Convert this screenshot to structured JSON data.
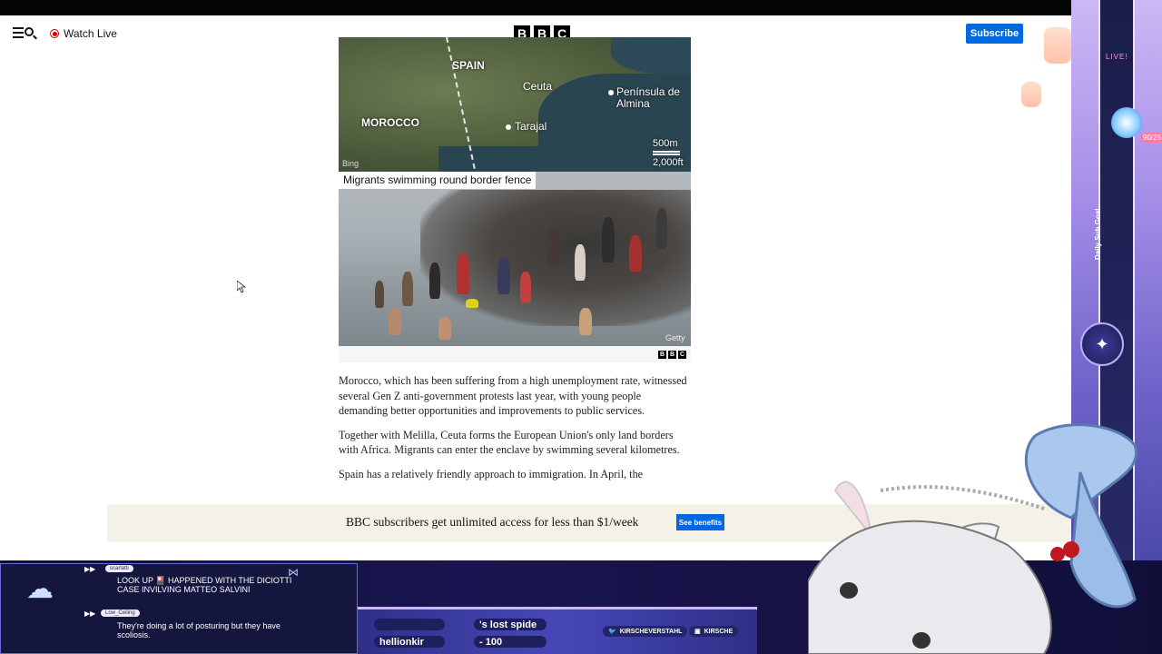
{
  "header": {
    "watch_live": "Watch Live",
    "logo_letters": [
      "B",
      "B",
      "C"
    ],
    "subscribe": "Subscribe"
  },
  "map": {
    "labels": {
      "spain": "SPAIN",
      "morocco": "MOROCCO",
      "ceuta": "Ceuta",
      "peninsula": "Península de Almina",
      "tarajal": "Tarajal"
    },
    "scale_top": "500m",
    "scale_bottom": "2,000ft",
    "source": "Bing"
  },
  "photo": {
    "caption": "Migrants swimming round border fence",
    "credit": "Getty"
  },
  "article": {
    "paragraphs": [
      "Morocco, which has been suffering from a high unemployment rate, witnessed several Gen Z anti-government protests last year, with young people demanding better opportunities and improvements to public services.",
      "Together with Melilla, Ceuta forms the European Union's only land borders with Africa. Migrants can enter the enclave by swimming several kilometres.",
      "Spain has a relatively friendly approach to immigration. In April, the"
    ]
  },
  "banner": {
    "text": "BBC subscribers get unlimited access for less than $1/week",
    "button": "See benefits"
  },
  "overlay": {
    "live_label": "LIVE!",
    "sub_goal": "Daily Sub Goal",
    "sub_count": "90/25",
    "chat": [
      {
        "user": "scarlatti",
        "text": "LOOK UP 🎴 HAPPENED WITH THE DICIOTTI CASE INVILVING MATTEO SALVINI"
      },
      {
        "user": "Low_Ceiling",
        "text": "They're doing a lot of posturing but they have scoliosis."
      }
    ],
    "ticker": {
      "item1": "'s lost spide",
      "item2": "hellionkir",
      "item3": "- 100"
    },
    "socials": [
      "KIRSCHEVERSTAHL",
      "KIRSCHE"
    ]
  }
}
